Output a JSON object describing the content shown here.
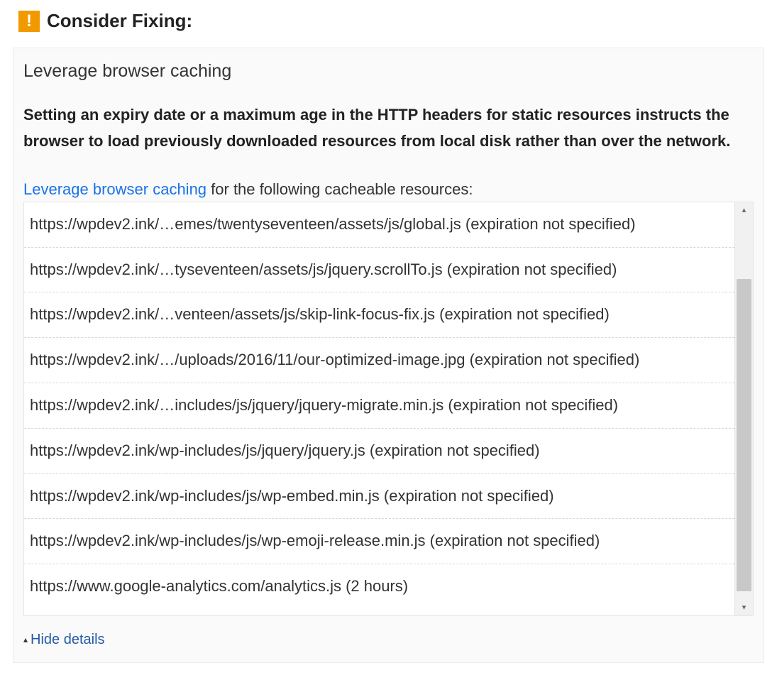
{
  "header": {
    "badge_glyph": "!",
    "title": "Consider Fixing:"
  },
  "issue": {
    "title": "Leverage browser caching",
    "description": "Setting an expiry date or a maximum age in the HTTP headers for static resources instructs the browser to load previously downloaded resources from local disk rather than over the network.",
    "action_link_text": "Leverage browser caching",
    "action_suffix": " for the following cacheable resources:"
  },
  "resources": [
    "https://wpdev2.ink/…emes/twentyseventeen/assets/js/global.js (expiration not specified)",
    "https://wpdev2.ink/…tyseventeen/assets/js/jquery.scrollTo.js (expiration not specified)",
    "https://wpdev2.ink/…venteen/assets/js/skip-link-focus-fix.js (expiration not specified)",
    "https://wpdev2.ink/…/uploads/2016/11/our-optimized-image.jpg (expiration not specified)",
    "https://wpdev2.ink/…includes/js/jquery/jquery-migrate.min.js (expiration not specified)",
    "https://wpdev2.ink/wp-includes/js/jquery/jquery.js (expiration not specified)",
    "https://wpdev2.ink/wp-includes/js/wp-embed.min.js (expiration not specified)",
    "https://wpdev2.ink/wp-includes/js/wp-emoji-release.min.js (expiration not specified)",
    "https://www.google-analytics.com/analytics.js (2 hours)"
  ],
  "footer": {
    "toggle_label": "Hide details"
  }
}
